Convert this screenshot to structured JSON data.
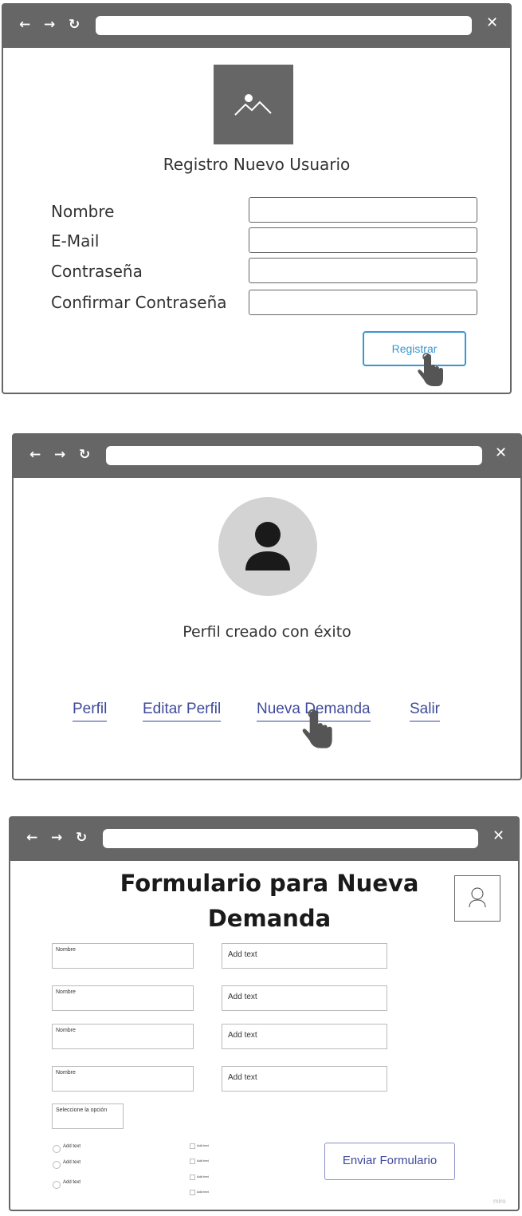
{
  "window1": {
    "nav": {
      "back": "←",
      "forward": "→",
      "refresh": "↻",
      "close": "✕"
    },
    "title": "Registro Nuevo Usuario",
    "fields": [
      {
        "label": "Nombre",
        "value": ""
      },
      {
        "label": "E-Mail",
        "value": ""
      },
      {
        "label": "Contraseña",
        "value": ""
      },
      {
        "label": "Confirmar Contraseña",
        "value": ""
      }
    ],
    "submit_label": "Registrar",
    "accent": "#3a96d0"
  },
  "window2": {
    "nav": {
      "back": "←",
      "forward": "→",
      "refresh": "↻",
      "close": "✕"
    },
    "message": "Perfil creado con éxito",
    "links": [
      "Perfil",
      "Editar Perfil",
      "Nueva Demanda",
      "Salir"
    ],
    "link_color": "#3f4a9a"
  },
  "window3": {
    "nav": {
      "back": "←",
      "forward": "→",
      "refresh": "↻",
      "close": "✕"
    },
    "title_line1": "Formulario para Nueva",
    "title_line2": "Demanda",
    "rows": [
      {
        "left": "Nombre",
        "right": "Add text"
      },
      {
        "left": "Nombre",
        "right": "Add text"
      },
      {
        "left": "Nombre",
        "right": "Add text"
      },
      {
        "left": "Nombre",
        "right": "Add text"
      }
    ],
    "select_label": "Seleccione la opción",
    "radios": [
      "Add text",
      "Add text",
      "Add text"
    ],
    "checks": [
      "Add text",
      "Add text",
      "Add text",
      "Add text"
    ],
    "submit_label": "Enviar Formulario",
    "watermark": "miro"
  }
}
